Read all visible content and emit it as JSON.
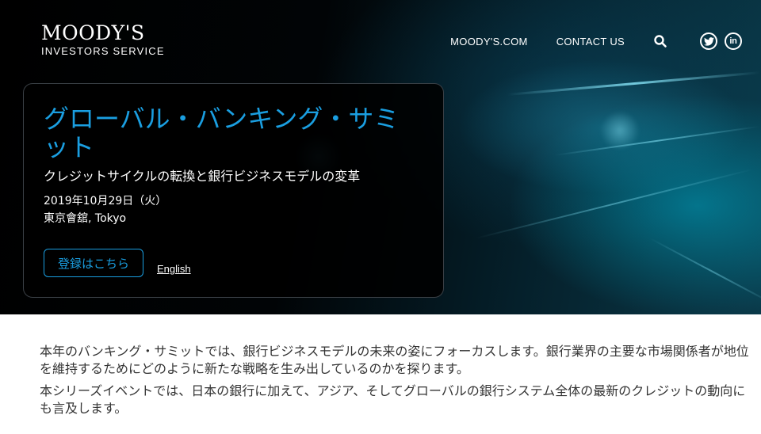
{
  "header": {
    "logo_main": "MOODY'S",
    "logo_sub": "INVESTORS SERVICE",
    "nav": [
      {
        "label": "MOODY'S.COM"
      },
      {
        "label": "CONTACT US"
      }
    ],
    "icons": [
      "search-icon",
      "twitter-icon",
      "linkedin-icon"
    ],
    "linkedin_glyph": "in"
  },
  "hero": {
    "title": "グローバル・バンキング・サミット",
    "subtitle": "クレジットサイクルの転換と銀行ビジネスモデルの変革",
    "date": "2019年10月29日（火）",
    "venue": "東京會舘, Tokyo",
    "register_label": "登録はこちら",
    "english_label": "English"
  },
  "body": {
    "paragraphs": [
      "本年のバンキング・サミットでは、銀行ビジネスモデルの未来の姿にフォーカスします。銀行業界の主要な市場関係者が地位を維持するためにどのように新たな戦略を生み出しているのかを探ります。",
      "本シリーズイベントでは、日本の銀行に加えて、アジア、そしてグローバルの銀行システム全体の最新のクレジットの動向にも言及します。"
    ]
  },
  "colors": {
    "accent": "#1a9ee0",
    "hero_bg": "#000000",
    "body_text": "#333333"
  }
}
